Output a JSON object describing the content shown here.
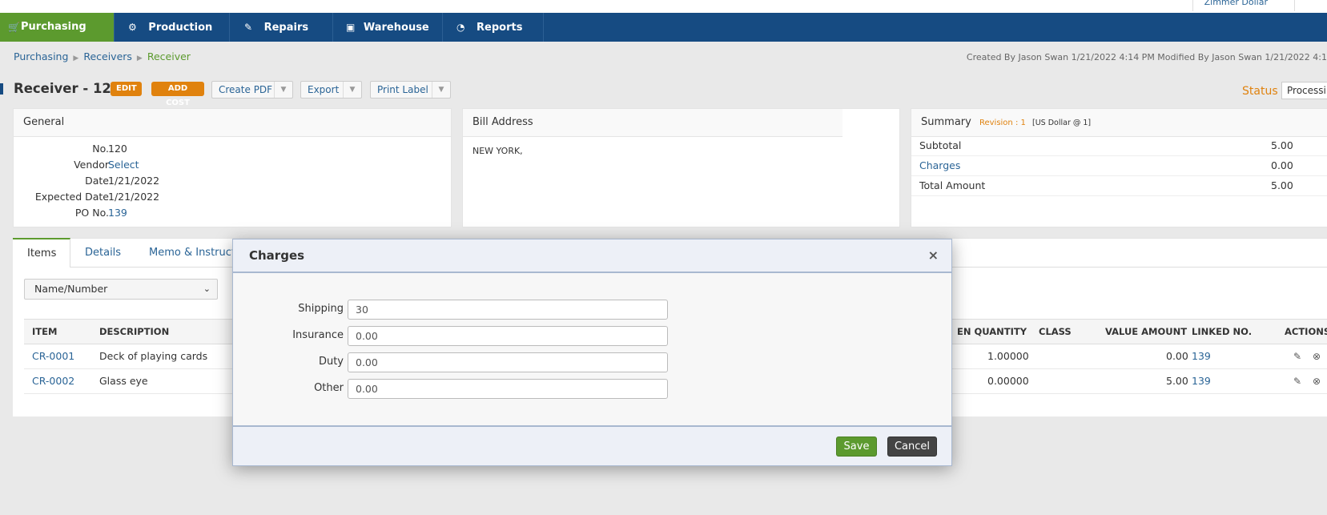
{
  "topbar": {
    "user": "Zimmer Dollar"
  },
  "nav": [
    {
      "label": "Purchasing",
      "icon": "cart-icon",
      "glyph": "🛒"
    },
    {
      "label": "Production",
      "icon": "gears-icon",
      "glyph": "⚙"
    },
    {
      "label": "Repairs",
      "icon": "tag-icon",
      "glyph": "✎"
    },
    {
      "label": "Warehouse",
      "icon": "box-icon",
      "glyph": "▣"
    },
    {
      "label": "Reports",
      "icon": "pie-chart-icon",
      "glyph": "◔"
    }
  ],
  "breadcrumb": {
    "items": [
      "Purchasing",
      "Receivers",
      "Receiver"
    ]
  },
  "meta": "Created By Jason Swan 1/21/2022 4:14 PM   Modified By Jason Swan 1/21/2022 4:1",
  "page": {
    "title": "Receiver - 120",
    "edit": "EDIT",
    "add_cost": "ADD COST",
    "create_pdf": "Create PDF",
    "export": "Export",
    "print_label": "Print Label",
    "status_label": "Status",
    "status_value": "Processing"
  },
  "general": {
    "title": "General",
    "fields": [
      {
        "label": "No.",
        "value": "120",
        "link": false
      },
      {
        "label": "Vendor",
        "value": "Select",
        "link": true
      },
      {
        "label": "Date",
        "value": "1/21/2022",
        "link": false
      },
      {
        "label": "Expected Date",
        "value": "1/21/2022",
        "link": false
      },
      {
        "label": "PO No.",
        "value": "139",
        "link": true
      }
    ]
  },
  "bill": {
    "title": "Bill Address",
    "address": "NEW YORK,"
  },
  "summary": {
    "title": "Summary",
    "revision": "Revision : 1",
    "currency": "[US Dollar @ 1]",
    "rows": [
      {
        "label": "Subtotal",
        "value": "5.00",
        "link": false
      },
      {
        "label": "Charges",
        "value": "0.00",
        "link": true
      },
      {
        "label": "Total Amount",
        "value": "5.00",
        "link": false
      }
    ]
  },
  "tabs": [
    "Items",
    "Details",
    "Memo & Instruct"
  ],
  "filter": {
    "value": "Name/Number"
  },
  "table": {
    "columns": [
      "ITEM",
      "DESCRIPTION",
      "EN QUANTITY",
      "CLASS",
      "VALUE AMOUNT",
      "LINKED NO.",
      "ACTIONS"
    ],
    "rows": [
      {
        "item": "CR-0001",
        "description": "Deck of playing cards",
        "qty": "1.00000",
        "class": "",
        "value": "0.00",
        "linked": "139"
      },
      {
        "item": "CR-0002",
        "description": "Glass eye",
        "qty": "0.00000",
        "class": "",
        "value": "5.00",
        "linked": "139"
      }
    ]
  },
  "modal": {
    "title": "Charges",
    "close": "×",
    "fields": [
      {
        "label": "Shipping",
        "value": "30"
      },
      {
        "label": "Insurance",
        "value": "0.00"
      },
      {
        "label": "Duty",
        "value": "0.00"
      },
      {
        "label": "Other",
        "value": "0.00"
      }
    ],
    "save": "Save",
    "cancel": "Cancel"
  },
  "colors": {
    "nav": "#164b82",
    "active": "#5c9a2e",
    "accent": "#e0820e",
    "link": "#2a6496"
  }
}
